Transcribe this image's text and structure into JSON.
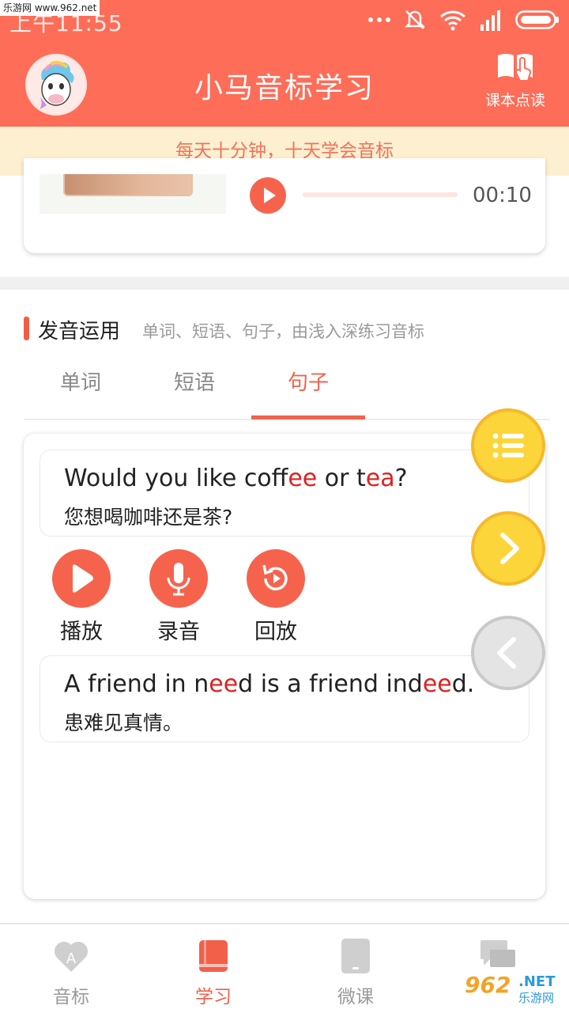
{
  "status_bar": {
    "time": "上午11:55",
    "watermark": "乐游网 www.962.net"
  },
  "header": {
    "title": "小马音标学习",
    "book_label": "课本点读"
  },
  "banner": {
    "text": "每天十分钟，十天学会音标"
  },
  "video": {
    "duration": "00:10",
    "progress": 0
  },
  "section": {
    "title": "发音运用",
    "subtitle": "单词、短语、句子，由浅入深练习音标"
  },
  "tabs": [
    {
      "label": "单词",
      "active": false
    },
    {
      "label": "短语",
      "active": false
    },
    {
      "label": "句子",
      "active": true
    }
  ],
  "sentences": [
    {
      "en_parts": [
        {
          "text": "Would you like coff",
          "hl": false
        },
        {
          "text": "ee",
          "hl": true
        },
        {
          "text": " or t",
          "hl": false
        },
        {
          "text": "ea",
          "hl": true
        },
        {
          "text": "?",
          "hl": false
        }
      ],
      "zh": "您想喝咖啡还是茶?"
    },
    {
      "en_parts": [
        {
          "text": "A friend in n",
          "hl": false
        },
        {
          "text": "ee",
          "hl": true
        },
        {
          "text": "d is a friend ind",
          "hl": false
        },
        {
          "text": "ee",
          "hl": true
        },
        {
          "text": "d.",
          "hl": false
        }
      ],
      "zh": "患难见真情。"
    }
  ],
  "controls": {
    "play": "播放",
    "record": "录音",
    "replay": "回放"
  },
  "bottom_nav": [
    {
      "label": "音标",
      "icon": "heart-a-icon",
      "active": false
    },
    {
      "label": "学习",
      "icon": "book-icon",
      "active": true
    },
    {
      "label": "微课",
      "icon": "tablet-icon",
      "active": false
    },
    {
      "label": "",
      "icon": "chat-icon",
      "active": false
    }
  ],
  "watermark_br": {
    "num": "962",
    "net": ".NET",
    "cn": "乐游网"
  },
  "colors": {
    "primary": "#fd6d58",
    "accent": "#f0634d",
    "highlight": "#e02020",
    "banner_bg": "#fdf0d0",
    "fab_yellow": "#fcd53a"
  }
}
